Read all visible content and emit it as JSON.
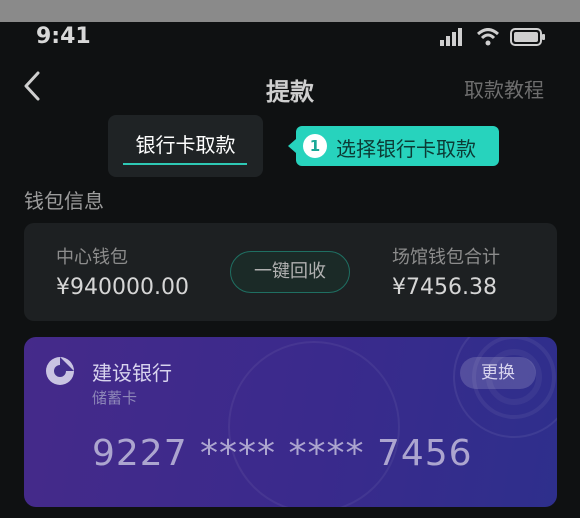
{
  "status": {
    "time": "9:41",
    "icons": [
      "signal-icon",
      "wifi-icon",
      "battery-icon"
    ]
  },
  "nav": {
    "title": "提款",
    "right_link": "取款教程",
    "back_icon": "chevron-left-icon"
  },
  "tab": {
    "label": "银行卡取款",
    "accent": "#2ec9b5"
  },
  "tooltip": {
    "step": "1",
    "text": "选择银行卡取款",
    "color": "#27d3bd"
  },
  "wallet": {
    "section_title": "钱包信息",
    "center_label": "中心钱包",
    "center_amount": "¥940000.00",
    "recycle_button": "一键回收",
    "venue_label": "场馆钱包合计",
    "venue_amount": "¥7456.38"
  },
  "card": {
    "bank_name": "建设银行",
    "card_type": "储蓄卡",
    "change_button": "更换",
    "number": "9227 **** **** 7456",
    "bank_icon": "ccb-logo-icon"
  }
}
